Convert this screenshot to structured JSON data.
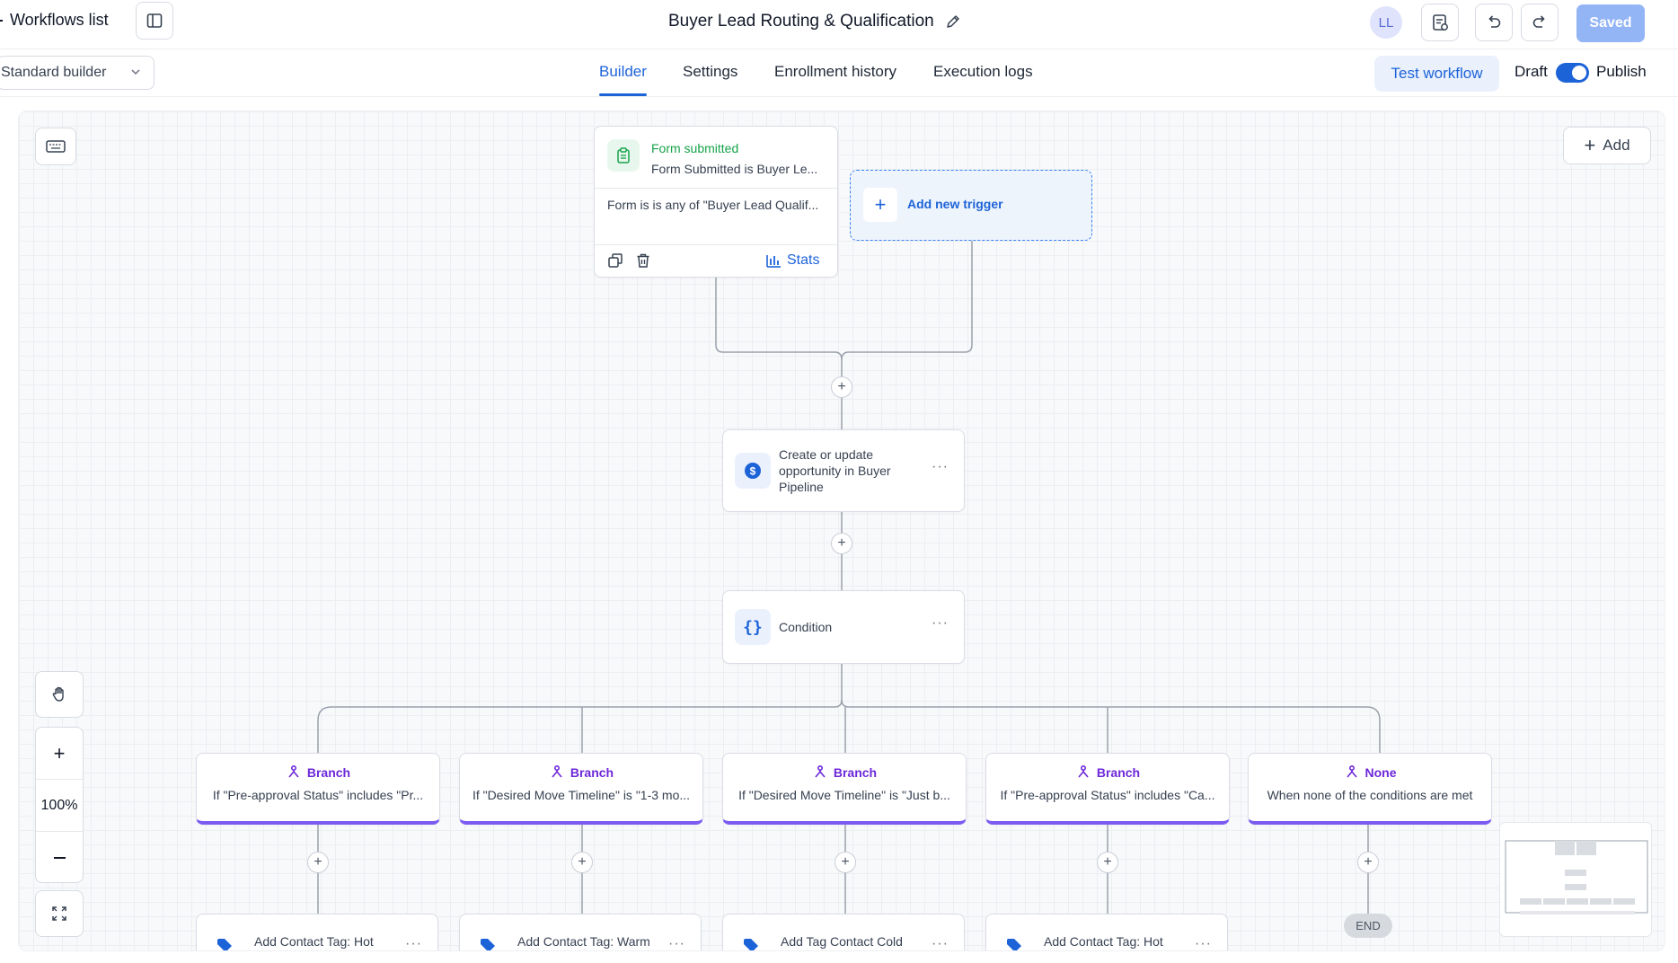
{
  "header": {
    "back_label": "Workflows list",
    "workflow_title": "Buyer Lead Routing & Qualification",
    "avatar_initials": "LL",
    "saved_label": "Saved"
  },
  "subheader": {
    "builder_select": "Standard builder",
    "tabs": [
      {
        "label": "Builder",
        "active": true
      },
      {
        "label": "Settings",
        "active": false
      },
      {
        "label": "Enrollment history",
        "active": false
      },
      {
        "label": "Execution logs",
        "active": false
      }
    ],
    "test_workflow_label": "Test workflow",
    "draft_label": "Draft",
    "publish_label": "Publish",
    "published": true
  },
  "canvas": {
    "add_label": "Add",
    "zoom_level": "100%",
    "trigger": {
      "title": "Form submitted",
      "subtitle": "Form Submitted is Buyer Le...",
      "filter": "Form is is any of \"Buyer Lead Qualif...",
      "stats_label": "Stats"
    },
    "add_trigger_label": "Add new trigger",
    "actions": [
      {
        "label": "Create or update opportunity in Buyer Pipeline",
        "icon": "dollar-icon"
      },
      {
        "label": "Condition",
        "icon": "braces-icon"
      }
    ],
    "branches": [
      {
        "title": "Branch",
        "desc": "If \"Pre-approval Status\" includes \"Pr..."
      },
      {
        "title": "Branch",
        "desc": "If \"Desired Move Timeline\" is \"1-3 mo..."
      },
      {
        "title": "Branch",
        "desc": "If \"Desired Move Timeline\" is \"Just b..."
      },
      {
        "title": "Branch",
        "desc": "If \"Pre-approval Status\" includes \"Ca..."
      },
      {
        "title": "None",
        "desc": "When none of the conditions are met"
      }
    ],
    "branch_actions": [
      {
        "label": "Add Contact Tag: Hot"
      },
      {
        "label": "Add Contact Tag: Warm"
      },
      {
        "label": "Add Tag Contact Cold"
      },
      {
        "label": "Add Contact Tag: Hot"
      }
    ],
    "end_label": "END"
  },
  "colors": {
    "accent": "#1d63d8",
    "branch": "#7c5cf0",
    "trigger_green": "#16a34a",
    "saved_button": "#93b4f5"
  }
}
